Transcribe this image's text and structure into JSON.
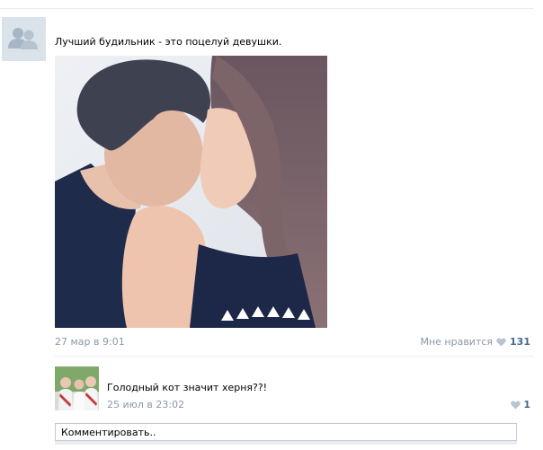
{
  "post": {
    "text": "Лучший будильник - это поцелуй девушки.",
    "date": "27 мар в 9:01",
    "like_label": "Мне нравится",
    "like_count": "131",
    "avatar_icon": "users-icon",
    "photo_alt": "photo"
  },
  "comment": {
    "text": "Голодный кот значит херня??!",
    "date": "25 июл в 23:02",
    "like_count": "1"
  },
  "comment_input": {
    "placeholder": "Комментировать.."
  },
  "colors": {
    "link": "#45688e",
    "muted": "#8a98a8",
    "avatar_bg": "#dae2ea"
  }
}
